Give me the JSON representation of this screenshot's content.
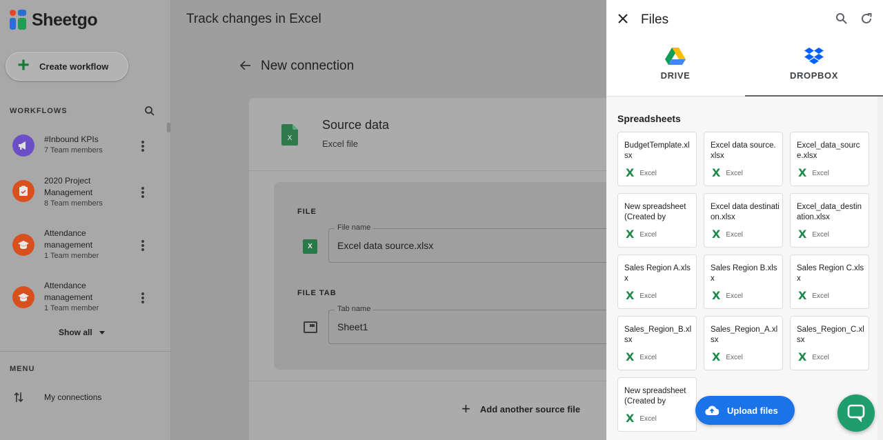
{
  "sidebar": {
    "brand": "Sheetgo",
    "create_label": "Create workflow",
    "workflows_heading": "WORKFLOWS",
    "workflows": [
      {
        "title": "#Inbound KPIs",
        "members": "7 Team members",
        "color": "#6c4fc6",
        "icon": "megaphone-icon"
      },
      {
        "title": "2020 Project Management",
        "members": "8 Team members",
        "color": "#d9501f",
        "icon": "clipboard-check-icon"
      },
      {
        "title": "Attendance management",
        "members": "1 Team member",
        "color": "#d9501f",
        "icon": "graduation-cap-icon"
      },
      {
        "title": "Attendance management",
        "members": "1 Team member",
        "color": "#d9501f",
        "icon": "graduation-cap-icon"
      }
    ],
    "show_all": "Show all",
    "menu_heading": "MENU",
    "menu_items": [
      {
        "label": "My connections",
        "icon": "arrows-up-down-icon"
      }
    ]
  },
  "main": {
    "title": "Track changes in Excel",
    "connection_title": "New connection",
    "source": {
      "title": "Source data",
      "subtitle": "Excel file"
    },
    "file_label": "FILE",
    "file_field": {
      "legend": "File name",
      "value": "Excel data source.xlsx"
    },
    "tab_label": "FILE TAB",
    "tab_field": {
      "legend": "Tab name",
      "value": "Sheet1"
    },
    "add_source": "Add another source file"
  },
  "panel": {
    "title": "Files",
    "tabs": [
      {
        "label": "DRIVE",
        "icon": "google-drive-icon"
      },
      {
        "label": "DROPBOX",
        "icon": "dropbox-icon",
        "active": true
      }
    ],
    "section": "Spreadsheets",
    "files": [
      {
        "name": "BudgetTemplate.xlsx",
        "type": "Excel"
      },
      {
        "name": "Excel data source.xlsx",
        "type": "Excel"
      },
      {
        "name": "Excel_data_source.xlsx",
        "type": "Excel"
      },
      {
        "name": "New spreadsheet (Created by",
        "type": "Excel"
      },
      {
        "name": "Excel data destination.xlsx",
        "type": "Excel"
      },
      {
        "name": "Excel_data_destination.xlsx",
        "type": "Excel"
      },
      {
        "name": "Sales Region A.xlsx",
        "type": "Excel"
      },
      {
        "name": "Sales Region B.xlsx",
        "type": "Excel"
      },
      {
        "name": "Sales Region C.xlsx",
        "type": "Excel"
      },
      {
        "name": "Sales_Region_B.xlsx",
        "type": "Excel"
      },
      {
        "name": "Sales_Region_A.xlsx",
        "type": "Excel"
      },
      {
        "name": "Sales_Region_C.xlsx",
        "type": "Excel"
      },
      {
        "name": "New spreadsheet (Created by",
        "type": "Excel"
      }
    ],
    "upload_label": "Upload files"
  },
  "colors": {
    "accent": "#1a73e8",
    "excel_green": "#1e8a4a",
    "chat": "#1f9d6b"
  }
}
